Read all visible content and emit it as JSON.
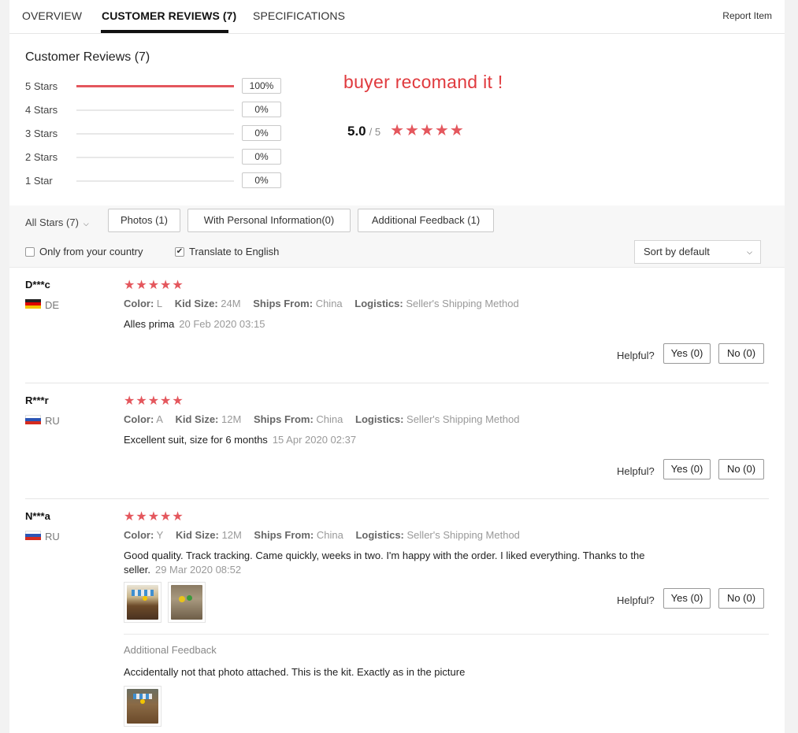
{
  "tabs": [
    {
      "label": "OVERVIEW"
    },
    {
      "label": "CUSTOMER REVIEWS (7)"
    },
    {
      "label": "SPECIFICATIONS"
    }
  ],
  "report_label": "Report Item",
  "summary": {
    "title": "Customer Reviews (7)",
    "rows": [
      {
        "label": "5 Stars",
        "pct": "100%",
        "fraction": 1.0
      },
      {
        "label": "4 Stars",
        "pct": "0%",
        "fraction": 0
      },
      {
        "label": "3 Stars",
        "pct": "0%",
        "fraction": 0
      },
      {
        "label": "2 Stars",
        "pct": "0%",
        "fraction": 0
      },
      {
        "label": "1 Star",
        "pct": "0%",
        "fraction": 0
      }
    ],
    "promo": "buyer recomand it !",
    "avg": "5.0",
    "avg_of": "/ 5",
    "stars": "★★★★★"
  },
  "filters": {
    "all_stars": "All Stars (7)",
    "photos": "Photos (1)",
    "personal": "With Personal Information(0)",
    "additional": "Additional Feedback (1)",
    "only_country": "Only from your country",
    "translate": "Translate to English",
    "translate_check": "✔",
    "sort": "Sort by default"
  },
  "labels": {
    "color": "Color:",
    "kid_size": "Kid Size:",
    "ships_from": "Ships From:",
    "logistics": "Logistics:",
    "helpful": "Helpful?",
    "additional_feedback": "Additional Feedback"
  },
  "reviews": [
    {
      "name": "D***c",
      "country": "DE",
      "stars": "★★★★★",
      "color": "L",
      "size": "24M",
      "ships": "China",
      "logistics": "Seller's Shipping Method",
      "text": "Alles prima",
      "date": "20 Feb 2020 03:15",
      "yes": "Yes (0)",
      "no": "No (0)"
    },
    {
      "name": "R***r",
      "country": "RU",
      "stars": "★★★★★",
      "color": "A",
      "size": "12M",
      "ships": "China",
      "logistics": "Seller's Shipping Method",
      "text": "Excellent suit, size for 6 months",
      "date": "15 Apr 2020 02:37",
      "yes": "Yes (0)",
      "no": "No (0)"
    },
    {
      "name": "N***a",
      "country": "RU",
      "stars": "★★★★★",
      "color": "Y",
      "size": "12M",
      "ships": "China",
      "logistics": "Seller's Shipping Method",
      "text": "Good quality. Track tracking. Came quickly, weeks in two. I'm happy with the order. I liked everything. Thanks to the seller.",
      "date": "29 Mar 2020 08:52",
      "yes": "Yes (0)",
      "no": "No (0)",
      "additional_text": "Accidentally not that photo attached. This is the kit. Exactly as in the picture"
    }
  ],
  "colors": {
    "accent_red": "#e4575d",
    "promo_red": "#e03a3e"
  }
}
